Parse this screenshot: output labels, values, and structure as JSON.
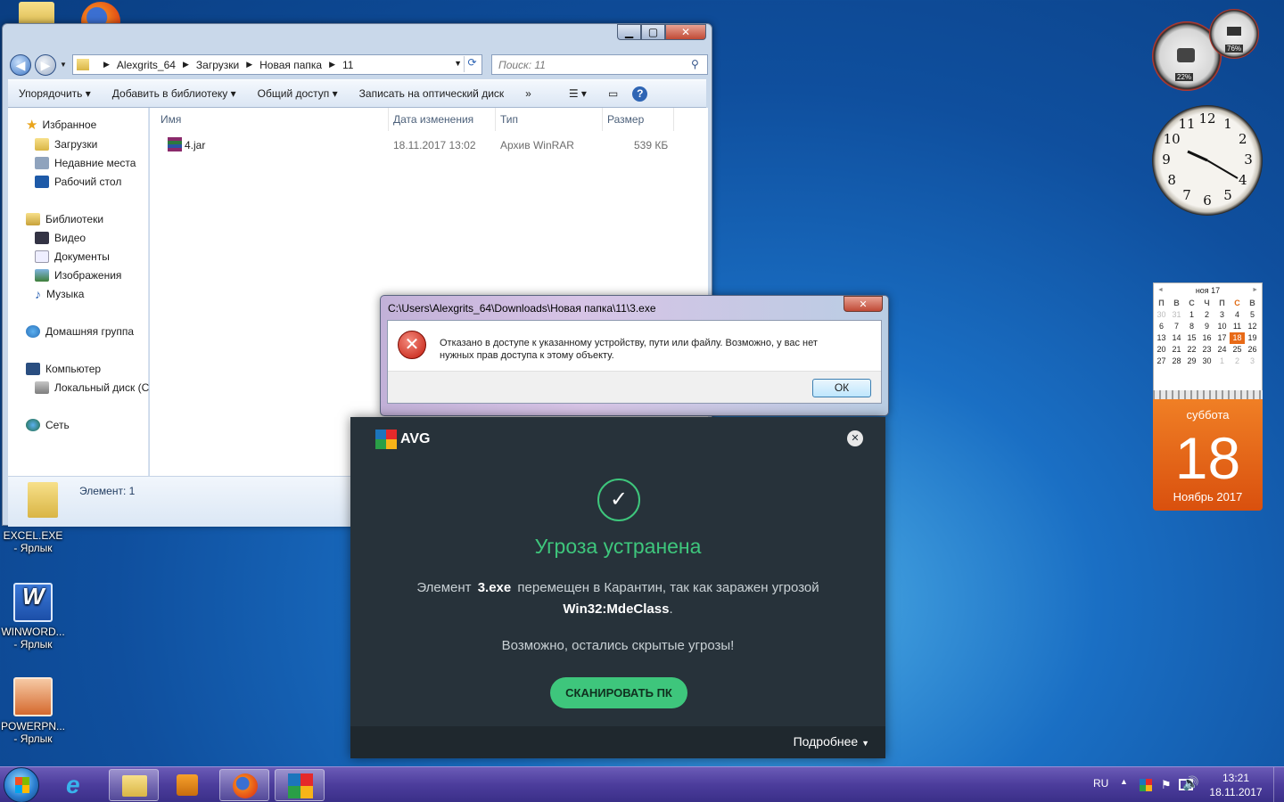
{
  "desktop": {
    "icons": [
      {
        "label": "EXCEL.EXE - Ярлык"
      },
      {
        "label": "WINWORD... - Ярлык"
      },
      {
        "label": "POWERPN... - Ярлык"
      }
    ]
  },
  "explorer": {
    "window_buttons": {
      "minimize": "▁",
      "maximize": "▢",
      "close": "✕"
    },
    "address": {
      "crumbs": [
        "Alexgrits_64",
        "Загрузки",
        "Новая папка",
        "11"
      ]
    },
    "search": {
      "placeholder": "Поиск: 11"
    },
    "toolbar": {
      "organize": "Упорядочить",
      "add_to_library": "Добавить в библиотеку",
      "share": "Общий доступ",
      "burn": "Записать на оптический диск",
      "more": "»"
    },
    "nav": {
      "favorites": "Избранное",
      "downloads": "Загрузки",
      "recent": "Недавние места",
      "desktop": "Рабочий стол",
      "libraries": "Библиотеки",
      "video": "Видео",
      "documents": "Документы",
      "images": "Изображения",
      "music": "Музыка",
      "homegroup": "Домашняя группа",
      "computer": "Компьютер",
      "local_disk": "Локальный диск (C",
      "network": "Сеть"
    },
    "columns": {
      "name": "Имя",
      "date": "Дата изменения",
      "type": "Тип",
      "size": "Размер"
    },
    "files": [
      {
        "name": "4.jar",
        "date": "18.11.2017 13:02",
        "type": "Архив WinRAR",
        "size": "539 КБ"
      }
    ],
    "details": {
      "count": "Элемент: 1"
    }
  },
  "error_dialog": {
    "title": "C:\\Users\\Alexgrits_64\\Downloads\\Новая папка\\11\\3.exe",
    "close": "✕",
    "message_line1": "Отказано в доступе к указанному устройству, пути или файлу. Возможно,  у вас нет",
    "message_line2": "нужных прав доступа к этому объекту.",
    "ok": "ОК"
  },
  "avg": {
    "brand": "AVG",
    "close": "✕",
    "headline": "Угроза устранена",
    "text_prefix": "Элемент",
    "filename": "3.exe",
    "text_middle": "перемещен в Карантин, так как заражен угрозой",
    "threat": "Win32:MdeClass",
    "text_end": ".",
    "hint": "Возможно, остались скрытые угрозы!",
    "scan_button": "СКАНИРОВАТЬ ПК",
    "more": "Подробнее",
    "colors": {
      "accent": "#3ec67c",
      "bg": "#27323a"
    }
  },
  "gadgets": {
    "cpu_percent": "22%",
    "mem_percent": "76%",
    "clock_numbers": [
      "12",
      "1",
      "2",
      "3",
      "4",
      "5",
      "6",
      "7",
      "8",
      "9",
      "10",
      "11"
    ],
    "calendar": {
      "month": "ноя 17",
      "prev": "◄",
      "next": "►",
      "weekdays": [
        "П",
        "В",
        "С",
        "Ч",
        "П",
        "С",
        "В"
      ],
      "weeks": [
        [
          "30",
          "31",
          "1",
          "2",
          "3",
          "4",
          "5"
        ],
        [
          "6",
          "7",
          "8",
          "9",
          "10",
          "11",
          "12"
        ],
        [
          "13",
          "14",
          "15",
          "16",
          "17",
          "18",
          "19"
        ],
        [
          "20",
          "21",
          "22",
          "23",
          "24",
          "25",
          "26"
        ],
        [
          "27",
          "28",
          "29",
          "30",
          "1",
          "2",
          "3"
        ]
      ],
      "day_name": "суббота",
      "day": "18",
      "month_year": "Ноябрь 2017"
    }
  },
  "taskbar": {
    "lang": "RU",
    "time": "13:21",
    "date": "18.11.2017"
  }
}
